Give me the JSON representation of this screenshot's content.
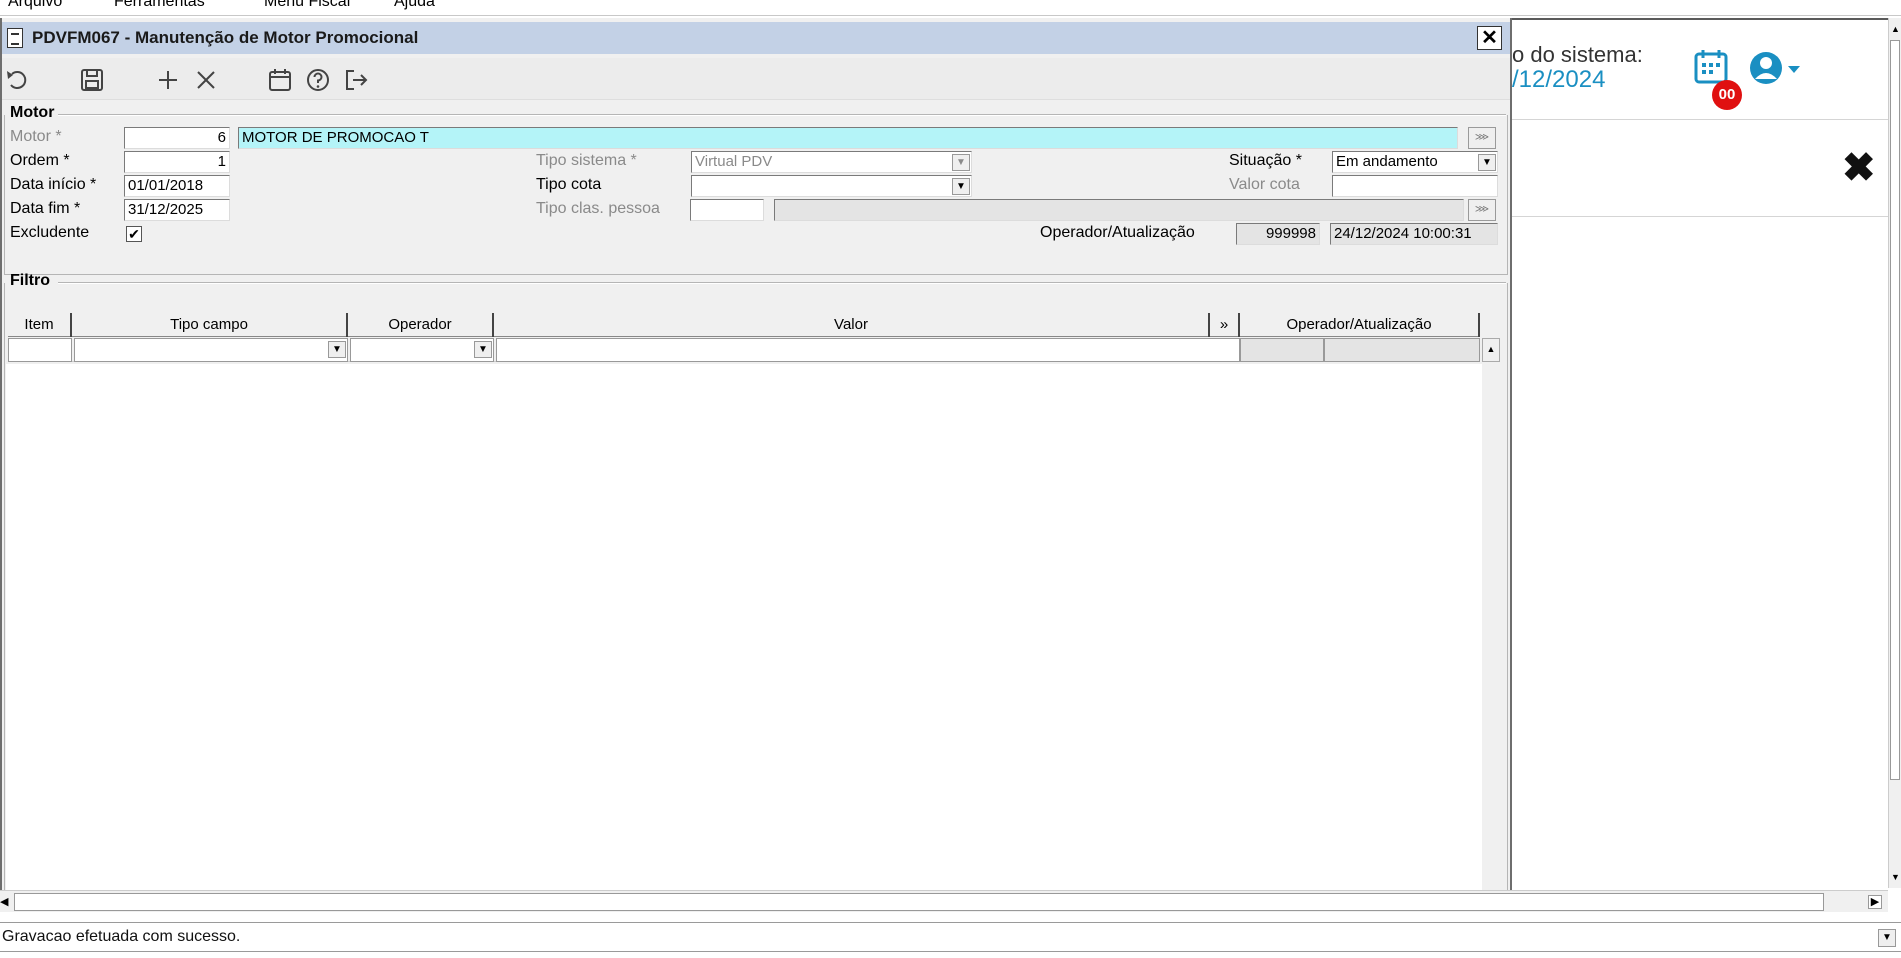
{
  "menu": {
    "items": [
      "Arquivo",
      "Ferramentas",
      "Menu Fiscal",
      "Ajuda"
    ]
  },
  "web": {
    "label_partial": "o do sistema:",
    "date_partial": "/12/2024",
    "badge": "00",
    "accent_color": "#1a8fc2"
  },
  "dialog": {
    "title": "PDVFM067 - Manutenção de Motor Promocional",
    "close": "✕",
    "toolbar": [
      "undo-icon",
      "save-icon",
      "add-icon",
      "delete-icon",
      "calendar-icon",
      "help-icon",
      "exit-icon"
    ]
  },
  "motor": {
    "group_title": "Motor",
    "motor_label": "Motor *",
    "motor_value": "6",
    "motor_desc": "MOTOR DE PROMOCAO T",
    "ordem_label": "Ordem *",
    "ordem_value": "1",
    "data_inicio_label": "Data início *",
    "data_inicio_value": "01/01/2018",
    "data_fim_label": "Data fim *",
    "data_fim_value": "31/12/2025",
    "excludente_label": "Excludente",
    "excludente_checked": "✔",
    "tipo_sistema_label": "Tipo sistema *",
    "tipo_sistema_value": "Virtual PDV",
    "tipo_cota_label": "Tipo cota",
    "tipo_cota_value": "",
    "tipo_clas_label": "Tipo clas. pessoa",
    "situacao_label": "Situação *",
    "situacao_value": "Em andamento",
    "valor_cota_label": "Valor cota",
    "valor_cota_value": "",
    "operador_label": "Operador/Atualização",
    "operador_value": "999998",
    "atualizacao_value": "24/12/2024 10:00:31"
  },
  "filtro": {
    "group_title": "Filtro",
    "columns": [
      "Item",
      "Tipo campo",
      "Operador",
      "Valor",
      "»",
      "Operador/Atualização"
    ]
  },
  "status": {
    "message": "Gravacao efetuada com sucesso."
  }
}
